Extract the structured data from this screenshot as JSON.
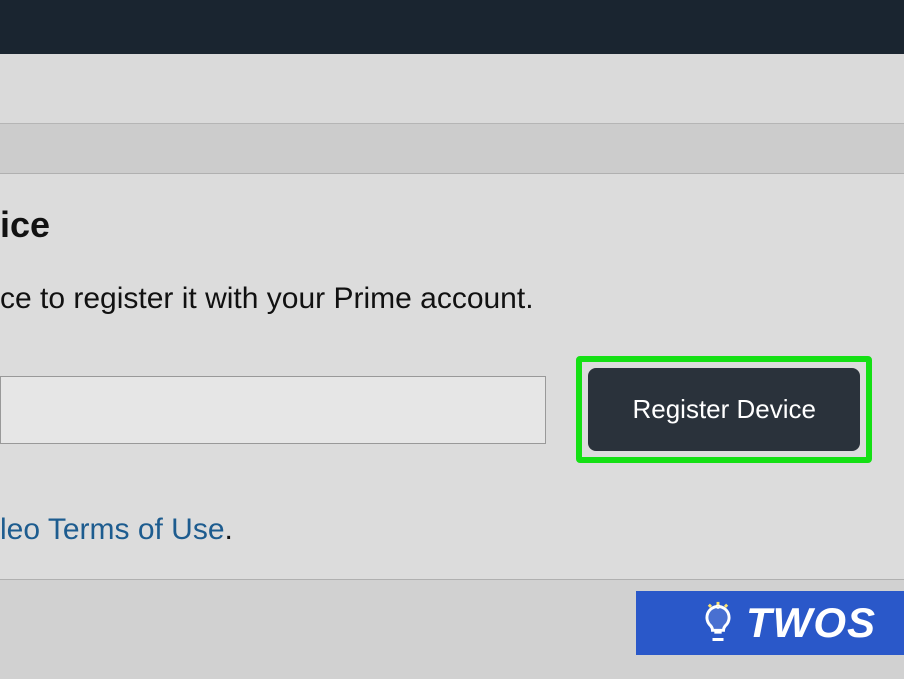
{
  "heading": "ice",
  "subtext": "ce to register it with your Prime account.",
  "register_button_label": "Register Device",
  "terms_link_text": "leo Terms of Use",
  "period": ".",
  "watermark": "TWOS",
  "colors": {
    "topbar": "#1a2530",
    "button_bg": "#2a323b",
    "highlight_border": "#14e014",
    "link_color": "#1d5c8f",
    "watermark_bg": "#2a58c9"
  }
}
